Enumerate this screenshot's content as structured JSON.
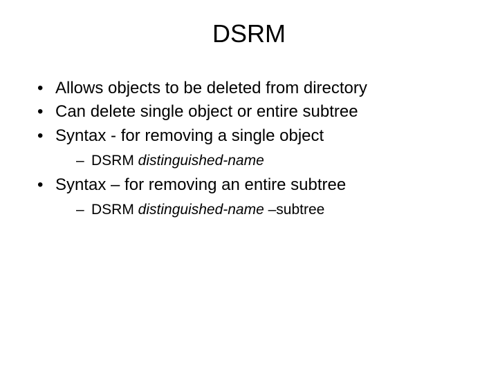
{
  "title": "DSRM",
  "bullets": [
    {
      "text": "Allows objects to be deleted from directory"
    },
    {
      "text": "Can delete single object or entire subtree"
    },
    {
      "text": "Syntax  - for removing a single object",
      "sub": [
        {
          "prefix": "DSRM ",
          "italic": "distinguished-name",
          "suffix": ""
        }
      ]
    },
    {
      "text": "Syntax – for removing an entire subtree",
      "sub": [
        {
          "prefix": "DSRM ",
          "italic": "distinguished-name",
          "suffix": " –subtree"
        }
      ]
    }
  ]
}
